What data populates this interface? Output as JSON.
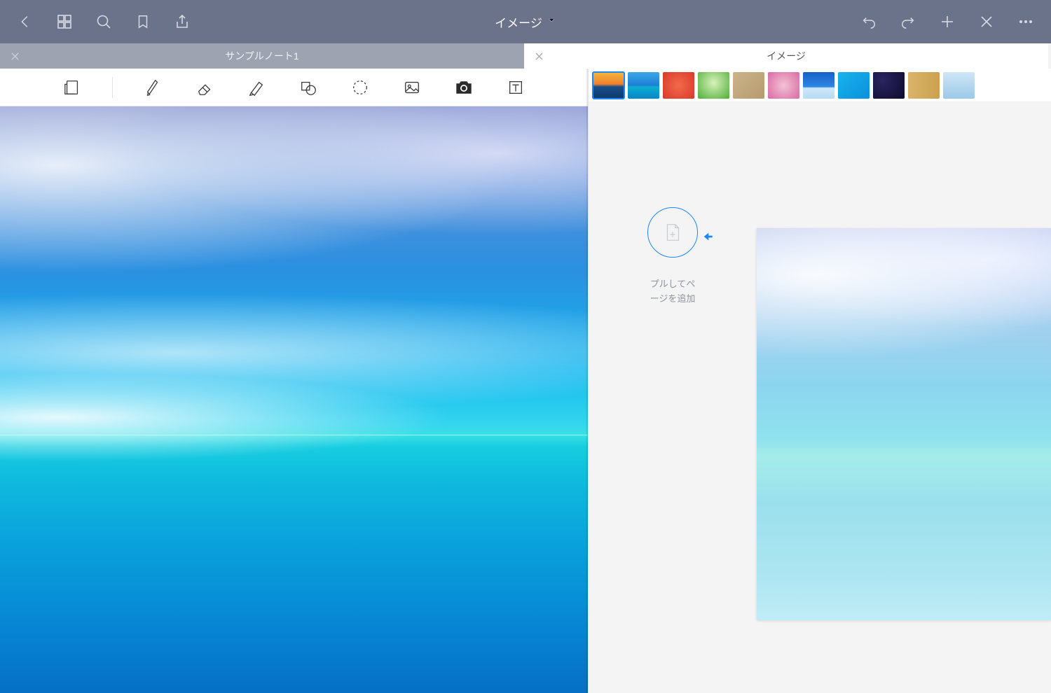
{
  "header": {
    "title": "イメージ"
  },
  "tabs": [
    {
      "label": "サンプルノート1",
      "active": false
    },
    {
      "label": "イメージ",
      "active": true
    }
  ],
  "right_panel": {
    "pull_hint_line1": "プルしてペ",
    "pull_hint_line2": "ージを追加"
  },
  "thumbnails": [
    {
      "name": "sunset",
      "bg": "linear-gradient(to bottom,#f6b83c 0%,#f07f2e 45%,#1b4f8a 55%,#0d3a6c 100%)",
      "selected": true
    },
    {
      "name": "ocean-sky",
      "bg": "linear-gradient(to bottom,#3aa7e8 0%,#1b7fd4 50%,#0baed2 55%,#0a86c6 100%)"
    },
    {
      "name": "autumn-red",
      "bg": "radial-gradient(circle at 50% 50%, #f46a4a, #d8392b)"
    },
    {
      "name": "green-leaves",
      "bg": "radial-gradient(circle at 50% 40%, #d7f2b9, #4fae3a)"
    },
    {
      "name": "sand",
      "bg": "linear-gradient(135deg,#cbb48b,#b79a6e)"
    },
    {
      "name": "blossom",
      "bg": "radial-gradient(circle at 50% 50%,#f3c2d4,#d96aa3)"
    },
    {
      "name": "bluesky",
      "bg": "linear-gradient(to bottom,#1560c8,#2f86e2 55%,#cfe6f8 60%,#b7dbf4 100%)"
    },
    {
      "name": "water-tex",
      "bg": "linear-gradient(135deg,#18b4ea,#0b8fdd)"
    },
    {
      "name": "night-stars",
      "bg": "radial-gradient(circle at 30% 30%,#2a2560,#0d0b2e)"
    },
    {
      "name": "wood",
      "bg": "linear-gradient(90deg,#d9b36a,#caa14f)"
    },
    {
      "name": "winter",
      "bg": "linear-gradient(to bottom,#cfe7f7,#9cc8e8)"
    }
  ]
}
